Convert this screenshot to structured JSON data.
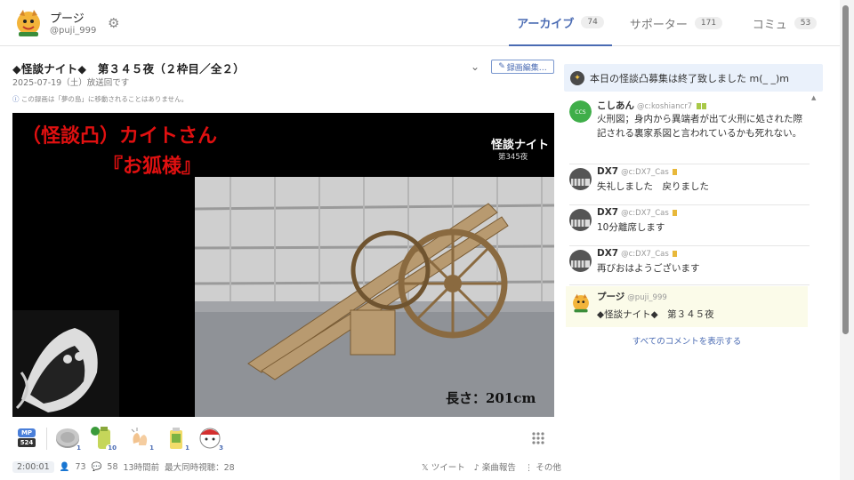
{
  "header": {
    "user_name": "プージ",
    "user_handle": "@puji_999",
    "tabs": [
      {
        "label": "アーカイブ",
        "count": "74"
      },
      {
        "label": "サポーター",
        "count": "171"
      },
      {
        "label": "コミュ",
        "count": "53"
      }
    ]
  },
  "broadcast": {
    "title": "◆怪談ナイト◆　第３４５夜（２枠目／全２）",
    "edit_label": "録画編集…",
    "date": "2025-07-19（土）放送回です",
    "notice": "この録画は「夢の島」に移動されることはありません。"
  },
  "video": {
    "title_line1": "（怪談凸）カイトさん",
    "title_line2": "『お狐様』",
    "logo": "怪談ナイト",
    "logo_sub": "第345夜",
    "length_caption": "長さ：201cm"
  },
  "gifts": {
    "mp_label": "MP",
    "mp_count": "524",
    "items": [
      {
        "icon": "coin-icon",
        "count": "1"
      },
      {
        "icon": "green-bottle-icon",
        "count": "10"
      },
      {
        "icon": "clapping-hands-icon",
        "count": "1"
      },
      {
        "icon": "yellow-drink-icon",
        "count": "1"
      },
      {
        "icon": "beckoning-cat-icon",
        "count": "3"
      }
    ]
  },
  "stats": {
    "duration": "2:00:01",
    "views": "73",
    "comments": "58",
    "ago": "13時間前",
    "max_viewers": "最大同時視聴：28"
  },
  "actions": {
    "tweet": "ツイート",
    "music_report": "楽曲報告",
    "other": "その他"
  },
  "announcement": "本日の怪談凸募集は終了致しました m(_ _)m",
  "comments": [
    {
      "name": "こしあん",
      "handle": "@c:koshiancr7",
      "text": "火刑図；身内から異端者が出て火刑に処された際記される裏家系図と言われているかも死れない。"
    },
    {
      "name": "DX7",
      "handle": "@c:DX7_Cas",
      "text": "失礼しました　戻りました"
    },
    {
      "name": "DX7",
      "handle": "@c:DX7_Cas",
      "text": "10分離席します"
    },
    {
      "name": "DX7",
      "handle": "@c:DX7_Cas",
      "text": "再びおはようございます"
    },
    {
      "name": "プージ",
      "handle": "@puji_999",
      "text": "◆怪談ナイト◆　第３４５夜"
    }
  ],
  "all_comments_link": "すべてのコメントを表示する",
  "colors": {
    "accent": "#4a6bb3",
    "title_red": "#e01010",
    "announce_bg": "#eaf1fb",
    "host_bg": "#fbfbe9"
  }
}
